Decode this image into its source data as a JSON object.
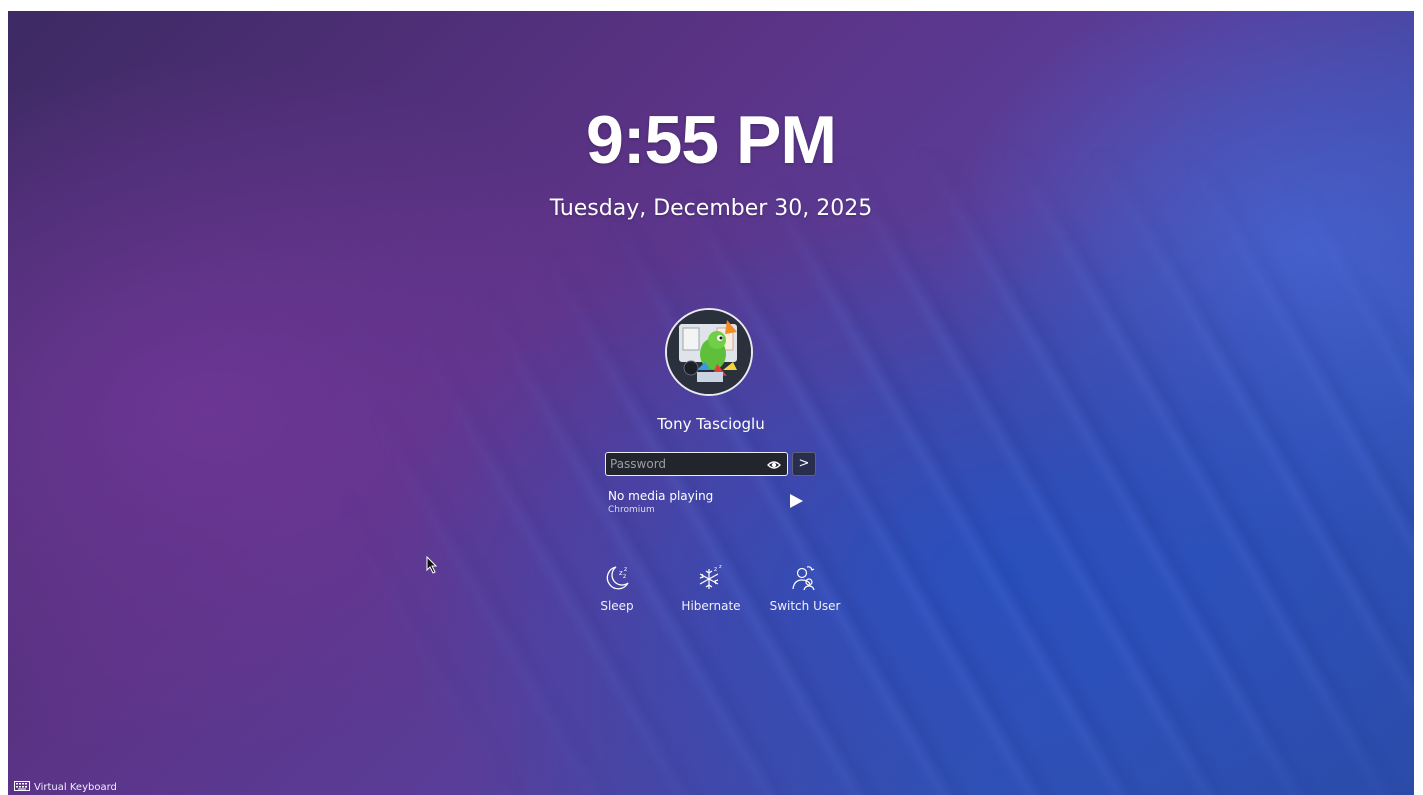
{
  "clock": {
    "time": "9:55 PM",
    "date": "Tuesday, December 30, 2025"
  },
  "user": {
    "name": "Tony Tascioglu"
  },
  "login": {
    "password_placeholder": "Password",
    "password_value": "",
    "submit_glyph": ">"
  },
  "media": {
    "title": "No media playing",
    "source": "Chromium"
  },
  "actions": [
    {
      "label": "Sleep",
      "icon": "sleep-icon"
    },
    {
      "label": "Hibernate",
      "icon": "hibernate-icon"
    },
    {
      "label": "Switch User",
      "icon": "switch-user-icon"
    }
  ],
  "footer": {
    "virtual_keyboard": "Virtual Keyboard"
  }
}
